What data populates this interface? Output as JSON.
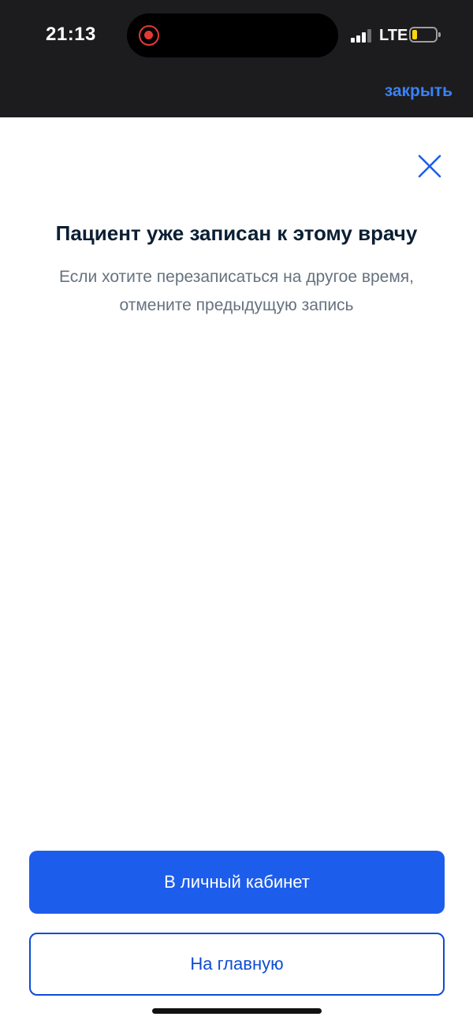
{
  "status_bar": {
    "time": "21:13",
    "network": "LTE",
    "icons": [
      "screen-recording-icon",
      "signal-icon",
      "battery-icon"
    ]
  },
  "header": {
    "close_link": "закрыть"
  },
  "dialog": {
    "title": "Пациент уже записан к этому врачу",
    "subtitle_line1": "Если хотите перезаписаться на другое время,",
    "subtitle_line2": "отмените предыдущую запись",
    "close_icon": "close-icon"
  },
  "actions": {
    "primary_label": "В личный кабинет",
    "secondary_label": "На главную"
  },
  "colors": {
    "accent": "#1d5deb",
    "accent_dark": "#0d4cd3",
    "link": "#3a82f7",
    "title": "#0b1f33",
    "subtitle": "#66727f",
    "status_bg": "#1c1c1e",
    "battery_low": "#ffd60a",
    "recording": "#e53935"
  }
}
